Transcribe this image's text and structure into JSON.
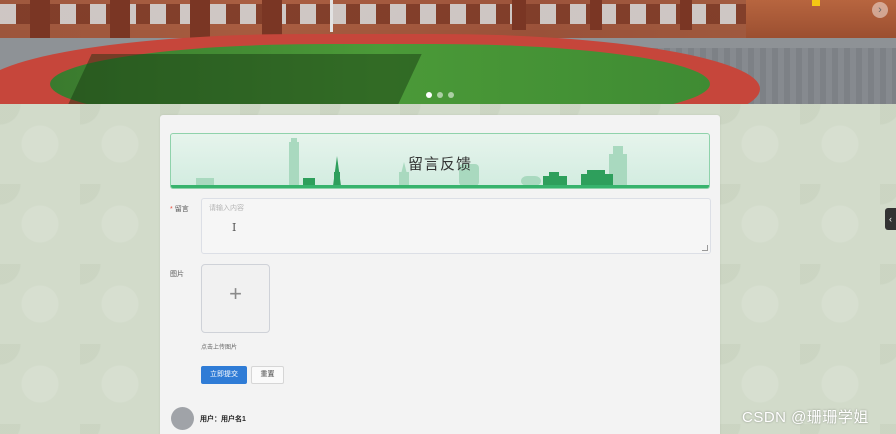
{
  "carousel": {
    "slide_count": 3,
    "active_slide": 1,
    "next_icon": "chevron-right-icon",
    "next_glyph": "›"
  },
  "side_tab": {
    "icon": "chevron-left-icon",
    "glyph": "‹"
  },
  "feedback": {
    "title": "留言反馈",
    "message_label": "留言",
    "message_required_mark": "*",
    "message_placeholder": "请输入内容",
    "image_label": "图片",
    "upload_icon": "plus-icon",
    "upload_glyph": "+",
    "upload_hint": "点击上传图片",
    "submit_label": "立即提交",
    "reset_label": "重置"
  },
  "comment": {
    "user_prefix": "用户：",
    "user_name": "用户名1"
  },
  "watermark": "CSDN @珊珊学姐",
  "colors": {
    "primary": "#2f7cd6",
    "header_accent": "#37b36d",
    "page_bg": "#d3dccb",
    "card_bg": "#f3f3f3"
  }
}
